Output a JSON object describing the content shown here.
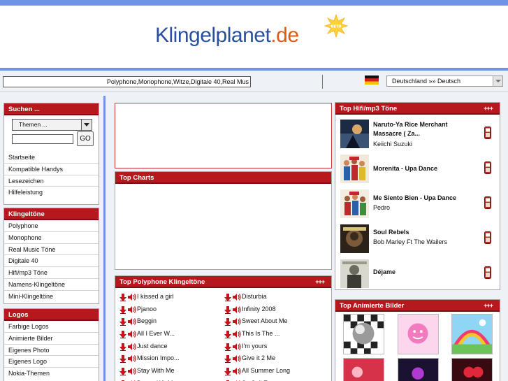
{
  "header": {
    "logo_text": "Klingelplanet",
    "logo_tld": ".de",
    "logo_badge": "BETA"
  },
  "ticker": {
    "text": "Polyphone,Monophone,Witze,Digitale 40,Real Mus"
  },
  "language": {
    "selected": "Deutschland »» Deutsch",
    "flag_icon": "german-flag-icon"
  },
  "sidebar": {
    "search": {
      "title": "Suchen ...",
      "themen_selected": "Themen ...",
      "go_label": "GO",
      "links": [
        "Startseite",
        "Kompatible Handys",
        "Lesezeichen",
        "Hilfeleistung"
      ]
    },
    "klingeltoene": {
      "title": "Klingeltöne",
      "links": [
        "Polyphone",
        "Monophone",
        "Real Music Töne",
        "Digitale 40",
        "Hifi/mp3 Töne",
        "Namens-Klingeltöne",
        "Mini-Klingeltöne"
      ]
    },
    "logos": {
      "title": "Logos",
      "links": [
        "Farbige Logos",
        "Animierte Bilder",
        "Eigenes Photo",
        "Eigenes Logo",
        "Nokia-Themen"
      ]
    }
  },
  "center": {
    "charts_title": "Top Charts",
    "poly_title": "Top Polyphone Klingeltöne",
    "poly_more": "+++",
    "poly_left": [
      "I kissed a girl",
      "Pjanoo",
      "Beggin",
      "All I Ever W...",
      "Just dance",
      "Mission Impo...",
      "Stay With Me",
      "Dance Wit Me"
    ],
    "poly_right": [
      "Disturbia",
      "Infinity 2008",
      "Sweet About Me",
      "This Is The ...",
      "I'm yours",
      "Give it 2 Me",
      "All Summer Long",
      "So Sail Ep..."
    ]
  },
  "right": {
    "hifi_title": "Top Hifi/mp3 Töne",
    "hifi_more": "+++",
    "hifi_items": [
      {
        "title": "Naruto-Ya Rice Merchant Massacre ( Za...",
        "artist": "Keiichi Suzuki"
      },
      {
        "title": "Morenita - Upa Dance",
        "artist": ""
      },
      {
        "title": "Me Siento Bien - Upa Dance",
        "artist": "Pedro"
      },
      {
        "title": "Soul Rebels",
        "artist": "Bob Marley Ft The Wailers"
      },
      {
        "title": "Déjame",
        "artist": ""
      }
    ],
    "anim_title": "Top Animierte Bilder",
    "anim_more": "+++"
  },
  "colors": {
    "accent_blue": "#6f93e6",
    "panel_red": "#b5191e",
    "logo_blue": "#2a4f9c",
    "logo_orange": "#e05a12"
  }
}
